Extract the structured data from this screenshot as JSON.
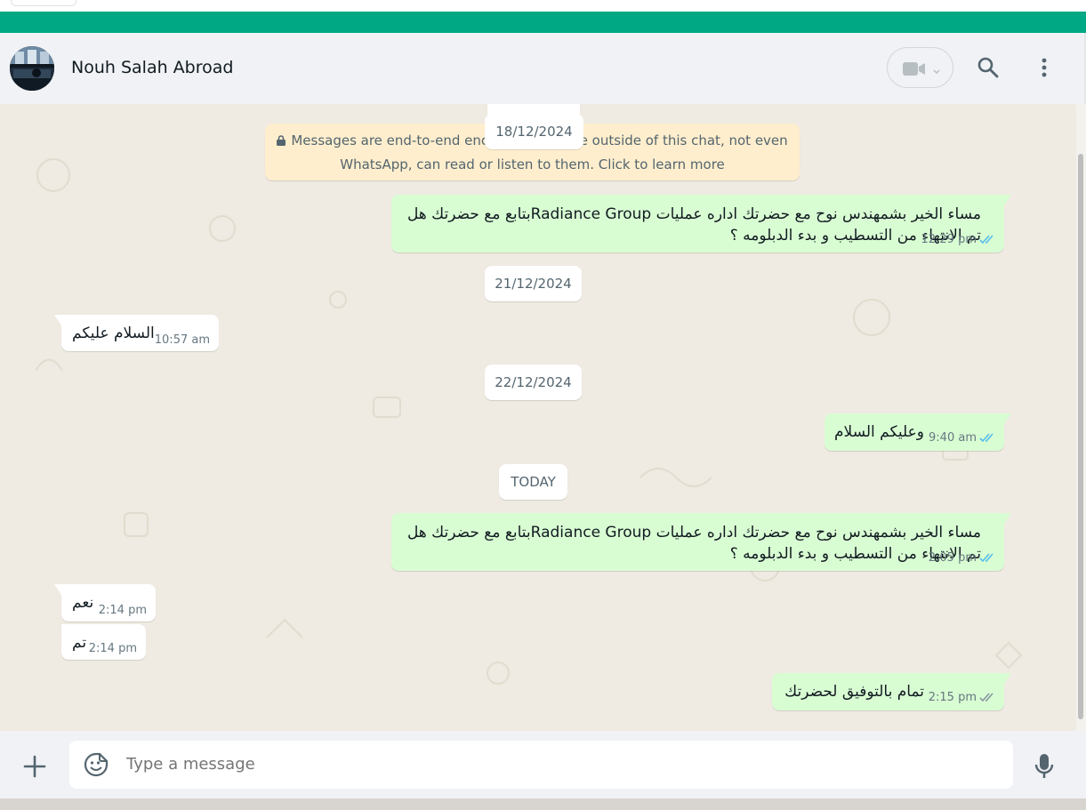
{
  "header": {
    "contact_name": "Nouh Salah Abroad"
  },
  "encryption_notice": {
    "line1": "Messages are end-to-end encrypted. No one outside of this chat, not even",
    "line2": "WhatsApp, can read or listen to them. Click to learn more"
  },
  "dates": [
    "18/12/2024",
    "21/12/2024",
    "22/12/2024",
    "TODAY"
  ],
  "messages": [
    {
      "direction": "out",
      "line1": "مساء الخير بشمهندس  نوح مع  حضرتك اداره عمليات Radiance Groupبتابع مع حضرتك هل",
      "line2": "تم الانتهاء من التسطيب و بدء الدبلومه ؟",
      "time": "12:29 pm",
      "status": "read"
    },
    {
      "direction": "in",
      "text": "السلام عليكم",
      "time": "10:57 am"
    },
    {
      "direction": "out",
      "text": "وعليكم السلام",
      "time": "9:40 am",
      "status": "read"
    },
    {
      "direction": "out",
      "line1": "مساء الخير بشمهندس  نوح مع  حضرتك اداره عمليات Radiance Groupبتابع مع حضرتك هل",
      "line2": "تم الانتهاء من التسطيب و بدء الدبلومه ؟",
      "time": "2:05 pm",
      "status": "read"
    },
    {
      "direction": "in",
      "text": "نعم",
      "time": "2:14 pm"
    },
    {
      "direction": "in",
      "text": "تم",
      "time": "2:14 pm"
    },
    {
      "direction": "out",
      "text": "تمام بالتوفيق لحضرتك",
      "time": "2:15 pm",
      "status": "delivered"
    }
  ],
  "composer": {
    "placeholder": "Type a message"
  },
  "colors": {
    "accent": "#00a884",
    "outgoing_bubble": "#d9fdd3",
    "read_tick": "#53bdeb",
    "delivered_tick": "#8696a0"
  },
  "icons": [
    "video-camera-icon",
    "chevron-down-icon",
    "search-icon",
    "menu-dots-icon",
    "lock-icon",
    "double-check-icon",
    "plus-icon",
    "sticker-icon",
    "microphone-icon"
  ]
}
